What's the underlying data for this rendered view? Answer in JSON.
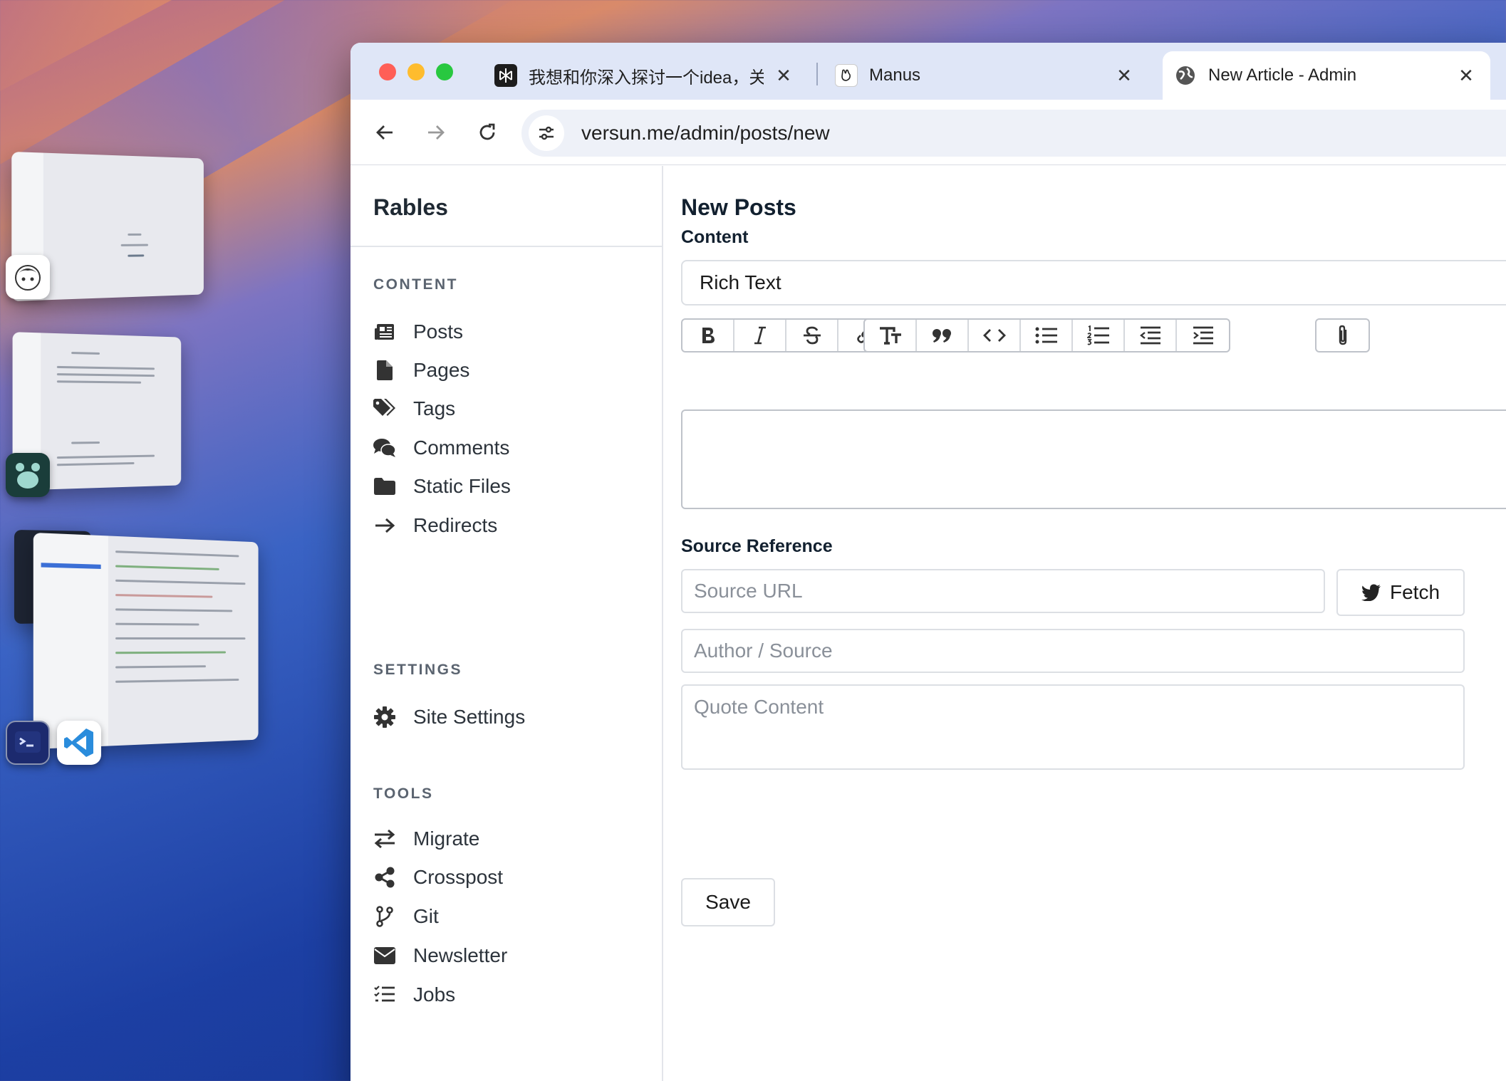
{
  "desktop": {
    "stage_apps": [
      "anime-avatar-app",
      "paw-app",
      "terminal-app",
      "vscode-app"
    ]
  },
  "browser": {
    "tabs": [
      {
        "title": "我想和你深入探讨一个idea，关",
        "icon": "perplexity-icon",
        "active": false
      },
      {
        "title": "Manus",
        "icon": "manus-icon",
        "active": false
      },
      {
        "title": "New Article - Admin",
        "icon": "globe-icon",
        "active": true
      }
    ],
    "url": "versun.me/admin/posts/new"
  },
  "sidebar": {
    "brand": "Rables",
    "sections": [
      {
        "heading": "CONTENT",
        "items": [
          {
            "label": "Posts",
            "icon": "newspaper-icon"
          },
          {
            "label": "Pages",
            "icon": "file-icon"
          },
          {
            "label": "Tags",
            "icon": "tags-icon"
          },
          {
            "label": "Comments",
            "icon": "comments-icon"
          },
          {
            "label": "Static Files",
            "icon": "folder-icon"
          },
          {
            "label": "Redirects",
            "icon": "arrow-right-icon"
          }
        ]
      },
      {
        "heading": "SETTINGS",
        "items": [
          {
            "label": "Site Settings",
            "icon": "gear-icon"
          }
        ]
      },
      {
        "heading": "TOOLS",
        "items": [
          {
            "label": "Migrate",
            "icon": "exchange-icon"
          },
          {
            "label": "Crosspost",
            "icon": "share-icon"
          },
          {
            "label": "Git",
            "icon": "git-branch-icon"
          },
          {
            "label": "Newsletter",
            "icon": "envelope-icon"
          },
          {
            "label": "Jobs",
            "icon": "list-check-icon"
          }
        ]
      }
    ]
  },
  "main": {
    "title": "New Posts",
    "content_label": "Content",
    "content_type": "Rich Text",
    "source_label": "Source Reference",
    "source_url_placeholder": "Source URL",
    "fetch_label": "Fetch",
    "author_placeholder": "Author / Source",
    "quote_placeholder": "Quote Content",
    "save_label": "Save",
    "cutoff_label": "S"
  },
  "colors": {
    "close": "#ff5f57",
    "minimize": "#febc2e",
    "zoom": "#28c840",
    "tabbar": "#dfe6f7"
  }
}
